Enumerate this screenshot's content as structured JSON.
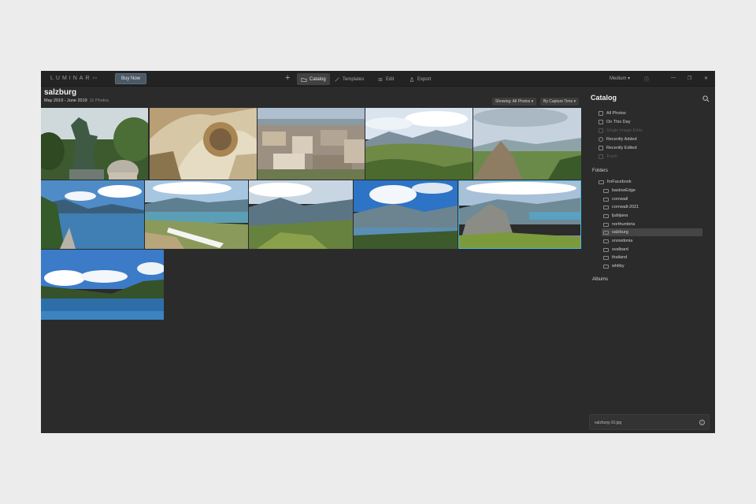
{
  "app": {
    "logo": "LUMINAR",
    "version": "4.1",
    "buy_label": "Buy Now",
    "add_icon": "plus-icon",
    "tabs": [
      {
        "label": "Catalog",
        "icon": "folder-icon",
        "active": true
      },
      {
        "label": "Templates",
        "icon": "templates-icon",
        "active": false
      },
      {
        "label": "Edit",
        "icon": "sliders-icon",
        "active": false
      },
      {
        "label": "Export",
        "icon": "share-icon",
        "active": false
      }
    ],
    "size_label": "Medium",
    "window_controls": [
      "help-icon",
      "minimize-icon",
      "maximize-icon",
      "close-icon"
    ]
  },
  "header": {
    "title": "salzburg",
    "date_range": "May 2019 - June 2019",
    "count": "11 Photos",
    "showing_label": "Showing: All Photos",
    "sort_label": "By Capture Time"
  },
  "photos": [
    {
      "name": "salzburg-1",
      "scene": "horse-statue"
    },
    {
      "name": "salzburg-2",
      "scene": "cathedral-ceiling"
    },
    {
      "name": "salzburg-3",
      "scene": "city-rooftops"
    },
    {
      "name": "salzburg-4",
      "scene": "valley-view"
    },
    {
      "name": "salzburg-5",
      "scene": "rocky-peak"
    },
    {
      "name": "salzburg-6",
      "scene": "lakeside-path"
    },
    {
      "name": "salzburg-7",
      "scene": "alpine-lake-snow"
    },
    {
      "name": "salzburg-8",
      "scene": "mountain-meadow"
    },
    {
      "name": "salzburg-9",
      "scene": "lake-overlook"
    },
    {
      "name": "salzburg-10",
      "scene": "cliff-ridge",
      "selected": true
    },
    {
      "name": "salzburg-11",
      "scene": "blue-lake"
    }
  ],
  "sidebar": {
    "title": "Catalog",
    "search_icon": "search-icon",
    "library": [
      {
        "label": "All Photos",
        "disabled": false
      },
      {
        "label": "On This Day",
        "disabled": false
      },
      {
        "label": "Single Image Edits",
        "disabled": true
      },
      {
        "label": "Recently Added",
        "disabled": false
      },
      {
        "label": "Recently Edited",
        "disabled": false
      },
      {
        "label": "Trash",
        "disabled": true
      }
    ],
    "folders_label": "Folders",
    "root_folder": "forFacebook",
    "folders": [
      {
        "label": "baslowEdge",
        "selected": false
      },
      {
        "label": "cornwall",
        "selected": false
      },
      {
        "label": "cornwall-2021",
        "selected": false
      },
      {
        "label": "ljubljana",
        "selected": false
      },
      {
        "label": "northumbria",
        "selected": false
      },
      {
        "label": "salzburg",
        "selected": true
      },
      {
        "label": "snowdonia",
        "selected": false
      },
      {
        "label": "svalbard",
        "selected": false
      },
      {
        "label": "thailand",
        "selected": false
      },
      {
        "label": "whitby",
        "selected": false
      }
    ],
    "albums_label": "Albums",
    "file_name": "salzburg-10.jpg",
    "info_icon": "info-icon"
  },
  "colors": {
    "accent_selection": "#4fb6e0",
    "background": "#2b2b2b",
    "topbar": "#232323"
  }
}
